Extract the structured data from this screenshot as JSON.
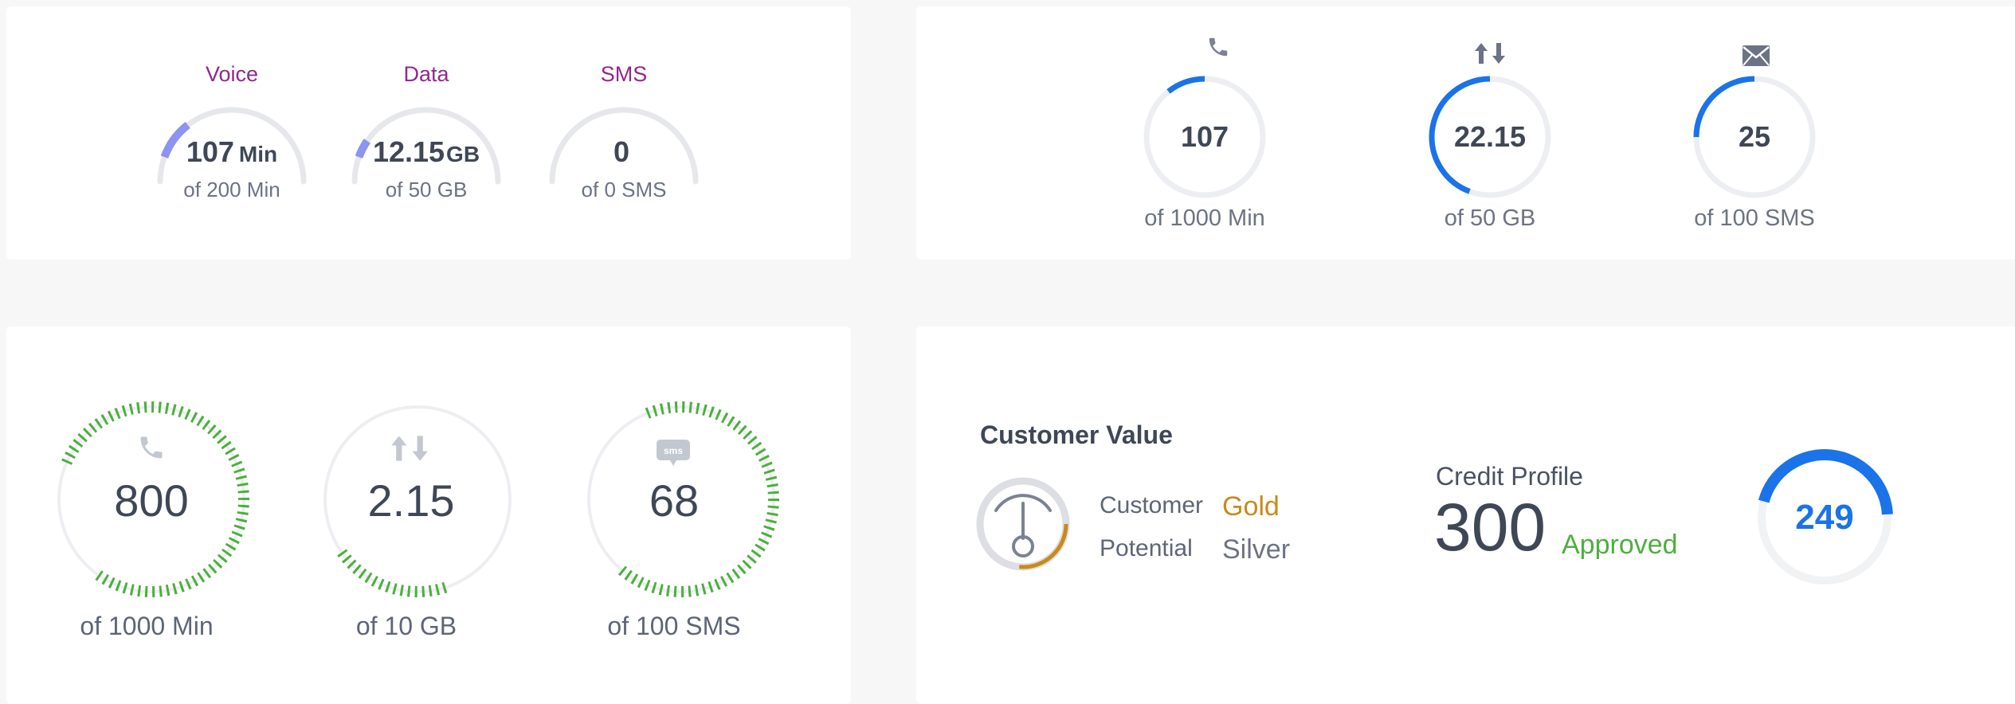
{
  "usage_semi": [
    {
      "label": "Voice",
      "value": "107",
      "unit": "Min",
      "sub": "of 200 Min",
      "fraction": 0.535
    },
    {
      "label": "Data",
      "value": "12.15",
      "unit": "GB",
      "sub": "of 50 GB",
      "fraction": 0.243
    },
    {
      "label": "SMS",
      "value": "0",
      "unit": "",
      "sub": "of 0 SMS",
      "fraction": 0
    }
  ],
  "usage_ring": [
    {
      "icon": "phone-icon",
      "value": "107",
      "sub": "of 1000 Min",
      "fraction": 0.107
    },
    {
      "icon": "data-transfer-icon",
      "value": "22.15",
      "sub": "of 50 GB",
      "fraction": 0.443
    },
    {
      "icon": "envelope-icon",
      "value": "25",
      "sub": "of 100 SMS",
      "fraction": 0.25
    }
  ],
  "usage_dashed": [
    {
      "icon": "phone-icon",
      "value": "800",
      "sub": "of 1000 Min",
      "fraction": 0.8
    },
    {
      "icon": "data-transfer-icon",
      "value": "2.15",
      "sub": "of 10 GB",
      "fraction": 0.215
    },
    {
      "icon": "sms-bubble-icon",
      "icon_text": "sms",
      "value": "68",
      "sub": "of 100 SMS",
      "fraction": 0.68
    }
  ],
  "customer_value": {
    "title": "Customer Value",
    "customer_label": "Customer",
    "customer_tier": "Gold",
    "potential_label": "Potential",
    "potential_tier": "Silver"
  },
  "credit_profile": {
    "title": "Credit Profile",
    "score": "300",
    "status": "Approved",
    "ring_value": "249",
    "ring_fraction": 0.45
  },
  "colors": {
    "semi_fill": "#8c94f0",
    "ring_fill": "#1a73e8",
    "dash_fill": "#4caf3e",
    "track": "#e6e7eb",
    "gold": "#c98a1b"
  }
}
